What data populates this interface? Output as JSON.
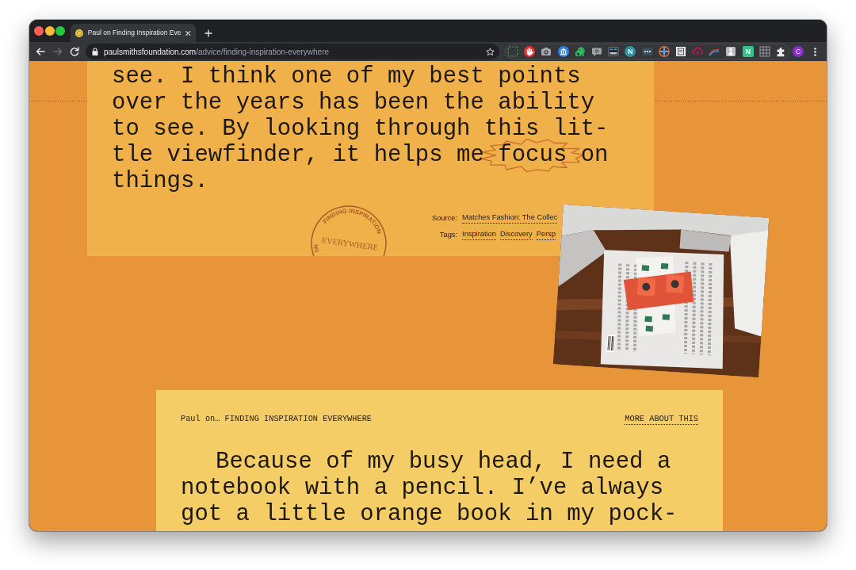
{
  "browser": {
    "tab": {
      "title": "Paul on Finding Inspiration Eve"
    },
    "nav_buttons": [
      {
        "kind": "back",
        "disabled": false
      },
      {
        "kind": "forward",
        "disabled": true
      },
      {
        "kind": "reload",
        "disabled": false
      }
    ],
    "address": {
      "host": "paulsmithsfoundation.com",
      "path": "/advice/finding-inspiration-everywhere"
    },
    "extensions": [
      {
        "kind": "dashed-square"
      },
      {
        "kind": "hand"
      },
      {
        "kind": "camera"
      },
      {
        "kind": "columns"
      },
      {
        "kind": "elephant"
      },
      {
        "kind": "speech-bubble"
      },
      {
        "kind": "screen"
      },
      {
        "kind": "letter-circle",
        "letter": "N"
      },
      {
        "kind": "more-dots"
      },
      {
        "kind": "crosshair"
      },
      {
        "kind": "document"
      },
      {
        "kind": "cloud"
      },
      {
        "kind": "swoosh"
      },
      {
        "kind": "person"
      },
      {
        "kind": "letter-square",
        "letter": "N"
      },
      {
        "kind": "grid"
      },
      {
        "kind": "puzzle"
      }
    ],
    "profile": {
      "initial": "C"
    }
  },
  "quote_card": {
    "lines": [
      [
        {
          "text": "see. I think one of my best points",
          "scribbled": false
        }
      ],
      [
        {
          "text": "over the years has been the ability",
          "scribbled": false
        }
      ],
      [
        {
          "text": "to see. By looking through this lit-",
          "scribbled": false
        }
      ],
      [
        {
          "text": "tle viewfinder, it helps me ",
          "scribbled": false
        },
        {
          "text": "focus",
          "scribbled": true
        },
        {
          "text": " on",
          "scribbled": false
        }
      ],
      [
        {
          "text": "things.",
          "scribbled": false
        }
      ]
    ],
    "stamp": {
      "arc_text": "FINDING INSPIRATION",
      "center_text": "EVERYWHERE",
      "lower_text": "NO"
    },
    "source": {
      "label": "Source:",
      "value": "Matches Fashion: The Collec"
    },
    "tags": {
      "label": "Tags:",
      "items": [
        "Inspiration",
        "Discovery",
        "Persp"
      ]
    }
  },
  "next_card": {
    "kicker": "Paul on… FINDING INSPIRATION EVERYWHERE",
    "more_link": "MORE ABOUT THIS",
    "lines": [
      "Because of my busy head, I need a",
      "notebook with a pencil. I’ve always",
      "got a little orange book in my pock-"
    ]
  }
}
